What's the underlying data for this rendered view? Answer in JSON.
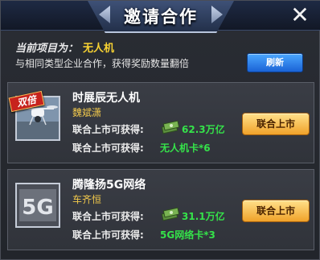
{
  "dialog": {
    "title": "邀请合作",
    "close_icon": "close-icon"
  },
  "header": {
    "project_label": "当前项目为：",
    "project_value": "无人机",
    "hint": "与相同类型企业合作，获得奖励数量翻倍",
    "refresh_label": "刷新"
  },
  "partners": [
    {
      "badge": "双倍",
      "name": "时展辰无人机",
      "ceo": "魏斌潇",
      "reward_label_1": "联合上市可获得:",
      "reward_value_1": "62.3万亿",
      "reward_label_2": "联合上市可获得:",
      "reward_value_2": "无人机卡*6",
      "button_label": "联合上市",
      "thumb_icon": "drone-icon"
    },
    {
      "name": "腾隆扬5G网络",
      "ceo": "车齐恒",
      "reward_label_1": "联合上市可获得:",
      "reward_value_1": "31.1万亿",
      "reward_label_2": "联合上市可获得:",
      "reward_value_2": "5G网络卡*3",
      "button_label": "联合上市",
      "thumb_icon": "5g-icon"
    }
  ],
  "colors": {
    "accent_gold": "#f7d232",
    "reward_green": "#35e24a",
    "button_orange": "#f0a22a",
    "button_blue": "#1b63d6",
    "badge_red": "#c7231d"
  }
}
